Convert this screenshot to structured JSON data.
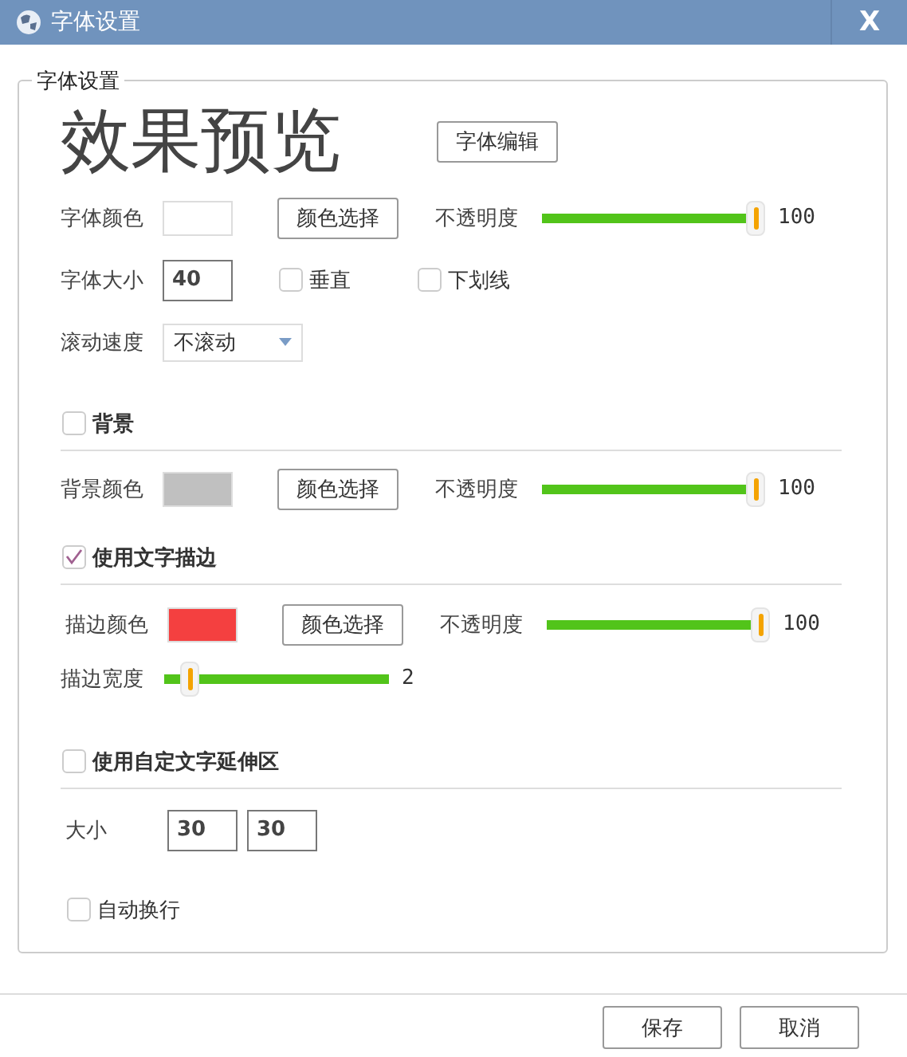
{
  "window": {
    "title": "字体设置",
    "close": "X"
  },
  "group": {
    "legend": "字体设置"
  },
  "preview": {
    "text": "效果预览",
    "button": "字体编辑"
  },
  "font_color": {
    "label": "字体颜色",
    "color": "#ffffff",
    "button": "颜色选择",
    "opacity_label": "不透明度",
    "level": 1,
    "reading": "100"
  },
  "font_size": {
    "label": "字体大小",
    "value": "40"
  },
  "options": [
    {
      "label": "垂直",
      "checked": false
    },
    {
      "label": "下划线",
      "checked": false
    }
  ],
  "scroll_speed": {
    "label": "滚动速度",
    "value": "不滚动"
  },
  "background": {
    "label": "背景",
    "checked": false,
    "color_label": "背景颜色",
    "color": "#c0c0c0",
    "button": "颜色选择",
    "opacity_label": "不透明度",
    "level": 1,
    "reading": "100"
  },
  "stroke": {
    "label": "使用文字描边",
    "checked": true,
    "color_label": "描边颜色",
    "color": "#f44040",
    "button": "颜色选择",
    "opacity_label": "不透明度",
    "level": 1,
    "reading": "100",
    "width": {
      "label": "描边宽度",
      "level": 0.08,
      "reading": "2"
    }
  },
  "extension": {
    "label": "使用自定文字延伸区",
    "checked": false,
    "size_label": "大小",
    "values": [
      "30",
      "30"
    ]
  },
  "auto_wrap": {
    "label": "自动换行",
    "checked": false
  },
  "buttons": [
    "保存",
    "取消"
  ]
}
